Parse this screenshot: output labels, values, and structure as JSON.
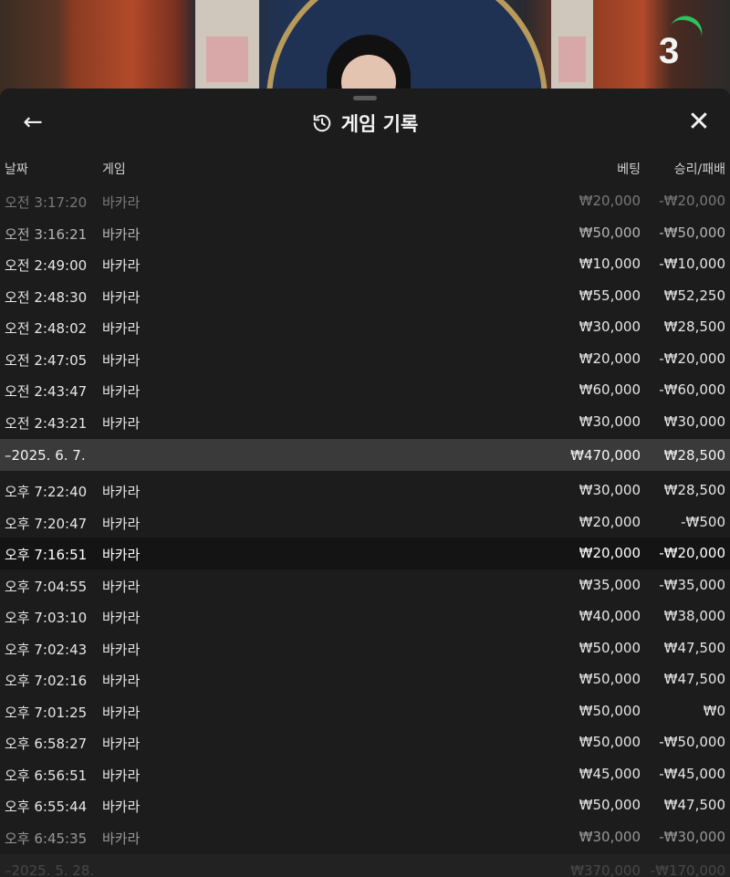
{
  "scene": {
    "round_counter": "3"
  },
  "header": {
    "title": "게임 기록",
    "back_icon": "←",
    "close_icon": "✕"
  },
  "columns": {
    "date": "날짜",
    "game": "게임",
    "bet": "베팅",
    "win_loss": "승리/패배"
  },
  "group1_rows": [
    {
      "time": "오전 3:17:20",
      "game": "바카라",
      "bet": "₩20,000",
      "result": "-₩20,000"
    },
    {
      "time": "오전 3:16:21",
      "game": "바카라",
      "bet": "₩50,000",
      "result": "-₩50,000"
    },
    {
      "time": "오전 2:49:00",
      "game": "바카라",
      "bet": "₩10,000",
      "result": "-₩10,000"
    },
    {
      "time": "오전 2:48:30",
      "game": "바카라",
      "bet": "₩55,000",
      "result": "₩52,250"
    },
    {
      "time": "오전 2:48:02",
      "game": "바카라",
      "bet": "₩30,000",
      "result": "₩28,500"
    },
    {
      "time": "오전 2:47:05",
      "game": "바카라",
      "bet": "₩20,000",
      "result": "-₩20,000"
    },
    {
      "time": "오전 2:43:47",
      "game": "바카라",
      "bet": "₩60,000",
      "result": "-₩60,000"
    },
    {
      "time": "오전 2:43:21",
      "game": "바카라",
      "bet": "₩30,000",
      "result": "₩30,000"
    }
  ],
  "date_group_1": {
    "label": "–2025. 6. 7.",
    "bet_total": "₩470,000",
    "result_total": "₩28,500"
  },
  "group2_rows": [
    {
      "time": "오후 7:22:40",
      "game": "바카라",
      "bet": "₩30,000",
      "result": "₩28,500"
    },
    {
      "time": "오후 7:20:47",
      "game": "바카라",
      "bet": "₩20,000",
      "result": "-₩500"
    },
    {
      "time": "오후 7:16:51",
      "game": "바카라",
      "bet": "₩20,000",
      "result": "-₩20,000"
    },
    {
      "time": "오후 7:04:55",
      "game": "바카라",
      "bet": "₩35,000",
      "result": "-₩35,000"
    },
    {
      "time": "오후 7:03:10",
      "game": "바카라",
      "bet": "₩40,000",
      "result": "₩38,000"
    },
    {
      "time": "오후 7:02:43",
      "game": "바카라",
      "bet": "₩50,000",
      "result": "₩47,500"
    },
    {
      "time": "오후 7:02:16",
      "game": "바카라",
      "bet": "₩50,000",
      "result": "₩47,500"
    },
    {
      "time": "오후 7:01:25",
      "game": "바카라",
      "bet": "₩50,000",
      "result": "₩0"
    },
    {
      "time": "오후 6:58:27",
      "game": "바카라",
      "bet": "₩50,000",
      "result": "-₩50,000"
    },
    {
      "time": "오후 6:56:51",
      "game": "바카라",
      "bet": "₩45,000",
      "result": "-₩45,000"
    },
    {
      "time": "오후 6:55:44",
      "game": "바카라",
      "bet": "₩50,000",
      "result": "₩47,500"
    },
    {
      "time": "오후 6:45:35",
      "game": "바카라",
      "bet": "₩30,000",
      "result": "-₩30,000"
    }
  ],
  "date_group_2": {
    "label": "–2025. 5. 28.",
    "bet_total": "₩370,000",
    "result_total": "-₩170,000"
  },
  "colors": {
    "sheet_bg": "#1c1c1c",
    "date_row_bg": "#3a3a3a",
    "highlight_row_bg": "#141414",
    "counter_arc": "#2ec25a"
  }
}
